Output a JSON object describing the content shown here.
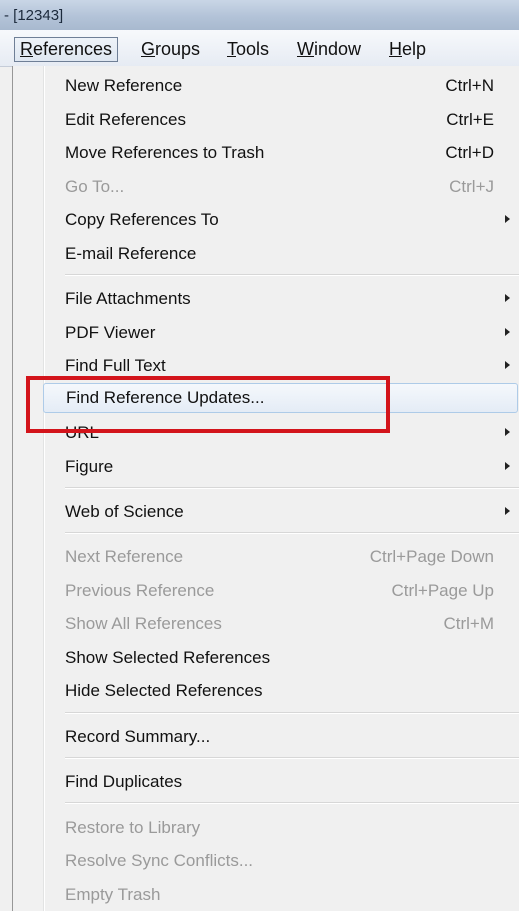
{
  "window": {
    "title": "- [12343]"
  },
  "menubar": {
    "items": [
      {
        "accel": "R",
        "rest": "eferences"
      },
      {
        "accel": "G",
        "rest": "roups"
      },
      {
        "accel": "T",
        "rest": "ools"
      },
      {
        "accel": "W",
        "rest": "indow"
      },
      {
        "accel": "H",
        "rest": "elp"
      }
    ]
  },
  "menu": {
    "items": [
      {
        "label": "New Reference",
        "shortcut": "Ctrl+N"
      },
      {
        "label": "Edit References",
        "shortcut": "Ctrl+E"
      },
      {
        "label": "Move References to Trash",
        "shortcut": "Ctrl+D"
      },
      {
        "label": "Go To...",
        "shortcut": "Ctrl+J",
        "disabled": true
      },
      {
        "label": "Copy References To",
        "submenu": true
      },
      {
        "label": "E-mail Reference"
      },
      {
        "label": "File Attachments",
        "submenu": true
      },
      {
        "label": "PDF Viewer",
        "submenu": true
      },
      {
        "label": "Find Full Text",
        "submenu": true
      },
      {
        "label": "Find Reference Updates...",
        "highlighted": true
      },
      {
        "label": "URL",
        "submenu": true
      },
      {
        "label": "Figure",
        "submenu": true
      },
      {
        "label": "Web of Science",
        "submenu": true
      },
      {
        "label": "Next Reference",
        "shortcut": "Ctrl+Page Down",
        "disabled": true
      },
      {
        "label": "Previous Reference",
        "shortcut": "Ctrl+Page Up",
        "disabled": true
      },
      {
        "label": "Show All References",
        "shortcut": "Ctrl+M",
        "disabled": true
      },
      {
        "label": "Show Selected References"
      },
      {
        "label": "Hide Selected References"
      },
      {
        "label": "Record Summary..."
      },
      {
        "label": "Find Duplicates"
      },
      {
        "label": "Restore to Library",
        "disabled": true
      },
      {
        "label": "Resolve Sync Conflicts...",
        "disabled": true
      },
      {
        "label": "Empty Trash",
        "disabled": true
      }
    ]
  },
  "colors": {
    "annotation_border": "#d3141b",
    "hover_border": "#aecbe8",
    "disabled_text": "#9a9a9a"
  }
}
